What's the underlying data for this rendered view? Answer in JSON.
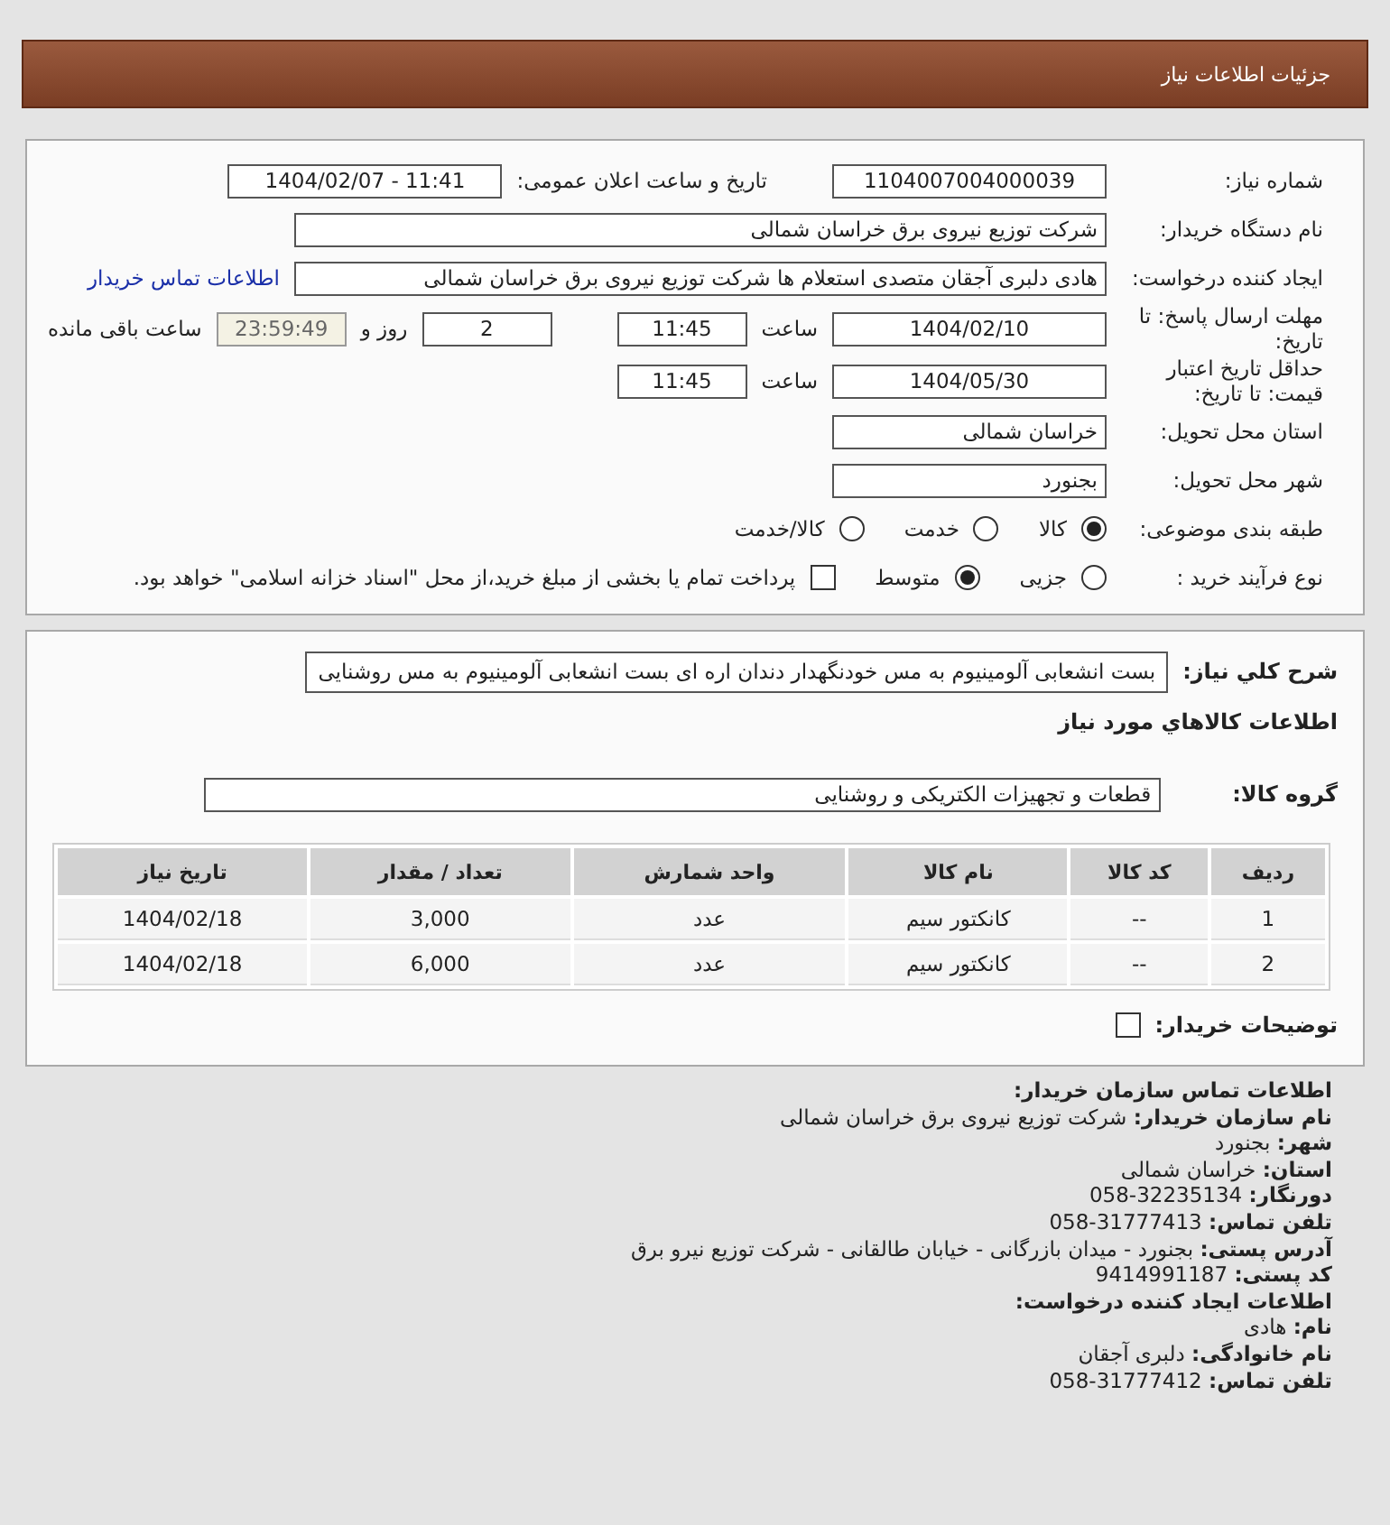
{
  "header": {
    "title": "جزئیات اطلاعات نیاز"
  },
  "need_number": {
    "label": "شماره نیاز:",
    "value": "1104007004000039"
  },
  "announce": {
    "label": "تاریخ و ساعت اعلان عمومی:",
    "value": "1404/02/07 - 11:41"
  },
  "buyer": {
    "label": "نام دستگاه خریدار:",
    "value": "شرکت توزیع نیروی برق خراسان شمالی"
  },
  "creator": {
    "label": "ایجاد کننده درخواست:",
    "value": "هادی دلبری آجقان متصدی استعلام ها شرکت توزیع نیروی برق خراسان شمالی",
    "link": "اطلاعات تماس خریدار"
  },
  "reply_deadline": {
    "label": "مهلت ارسال پاسخ: تا تاریخ:",
    "date": "1404/02/10",
    "time_label": "ساعت",
    "time": "11:45",
    "days": "2",
    "days_label": "روز و",
    "remaining": "23:59:49",
    "remaining_label": "ساعت باقی مانده"
  },
  "price_validity": {
    "label": "حداقل تاریخ اعتبار قیمت: تا تاریخ:",
    "date": "1404/05/30",
    "time_label": "ساعت",
    "time": "11:45"
  },
  "province": {
    "label": "استان محل تحویل:",
    "value": "خراسان شمالی"
  },
  "city": {
    "label": "شهر محل تحویل:",
    "value": "بجنورد"
  },
  "category": {
    "label": "طبقه بندی موضوعی:",
    "options": [
      {
        "label": "کالا",
        "selected": true
      },
      {
        "label": "خدمت",
        "selected": false
      },
      {
        "label": "کالا/خدمت",
        "selected": false
      }
    ]
  },
  "process": {
    "label": "نوع فرآیند خرید :",
    "options": [
      {
        "label": "جزیی",
        "selected": false
      },
      {
        "label": "متوسط",
        "selected": true
      }
    ],
    "payment": {
      "label": "پرداخت تمام یا بخشی از مبلغ خرید،از محل \"اسناد خزانه اسلامی\" خواهد بود.",
      "checked": false
    }
  },
  "description": {
    "label": "شرح کلي نياز:",
    "value": "بست انشعابی آلومینیوم به مس خودنگهدار دندان اره ای بست انشعابی آلومینیوم به مس روشنایی"
  },
  "goods_heading": "اطلاعات کالاهاي مورد نياز",
  "goods_group": {
    "label": "گروه کالا:",
    "value": "قطعات و تجهیزات الکتریکی و روشنایی"
  },
  "table": {
    "columns": [
      "ردیف",
      "کد کالا",
      "نام کالا",
      "واحد شمارش",
      "تعداد / مقدار",
      "تاریخ نیاز"
    ],
    "rows": [
      [
        "1",
        "--",
        "کانکتور سیم",
        "عدد",
        "3,000",
        "1404/02/18"
      ],
      [
        "2",
        "--",
        "کانکتور سیم",
        "عدد",
        "6,000",
        "1404/02/18"
      ]
    ]
  },
  "buyer_notes": {
    "label": "توضیحات خریدار:",
    "checked": false
  },
  "contact": [
    {
      "kind": "heading",
      "text": "اطلاعات تماس سازمان خریدار:"
    },
    {
      "kind": "line",
      "text": "**نام سازمان خریدار:** شرکت توزیع نیروی برق خراسان شمالی"
    },
    {
      "kind": "line",
      "text": "**شهر:** بجنورد"
    },
    {
      "kind": "line",
      "text": "**استان:** خراسان شمالی"
    },
    {
      "kind": "line",
      "text": "**دورنگار:** 32235134-058"
    },
    {
      "kind": "line",
      "text": "**تلفن تماس:** 31777413-058"
    },
    {
      "kind": "line",
      "text": "**آدرس پستی:** بجنورد - میدان بازرگانی - خیابان طالقانی - شرکت توزیع نیرو برق"
    },
    {
      "kind": "line",
      "text": "**کد پستی:** 9414991187"
    },
    {
      "kind": "heading",
      "text": "اطلاعات ایجاد کننده درخواست:"
    },
    {
      "kind": "line",
      "text": "**نام:** هادی"
    },
    {
      "kind": "line",
      "text": "**نام خانوادگی:** دلبری آجقان"
    },
    {
      "kind": "line",
      "text": "**تلفن تماس:** 31777412-058"
    }
  ]
}
